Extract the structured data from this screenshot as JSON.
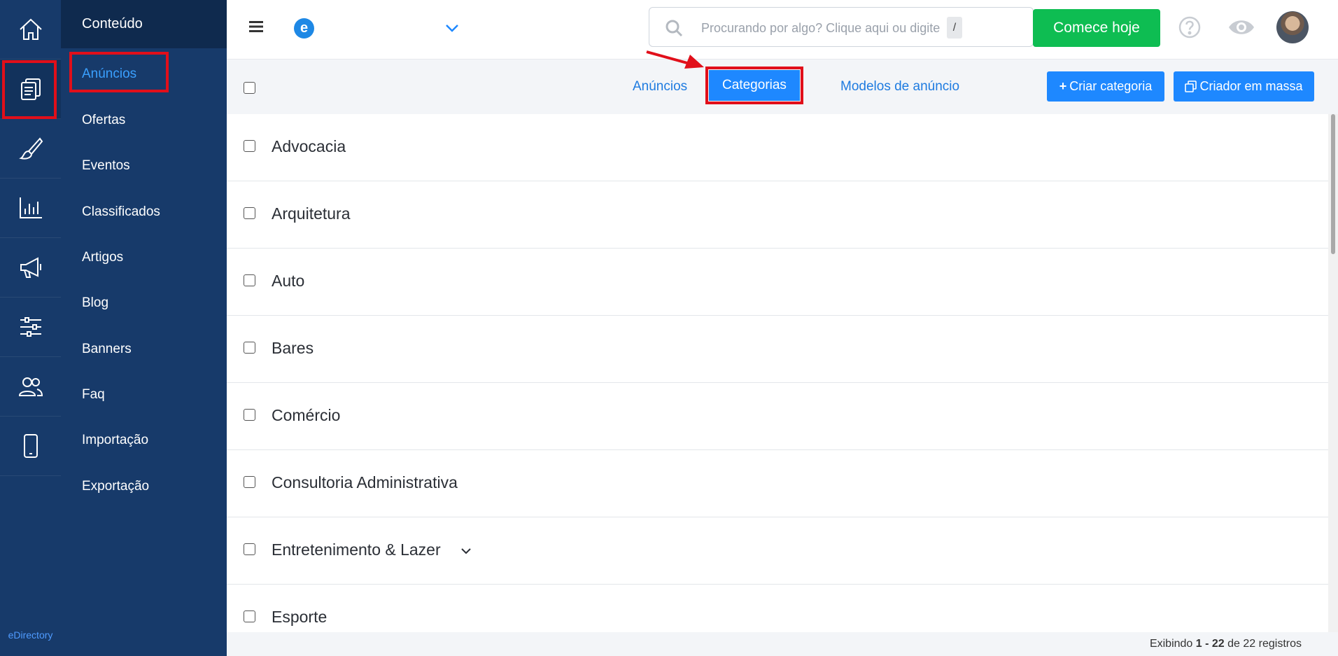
{
  "brand": "eDirectory",
  "sidebar": {
    "section_title": "Conteúdo",
    "items": [
      {
        "label": "Anúncios",
        "active": true
      },
      {
        "label": "Ofertas"
      },
      {
        "label": "Eventos"
      },
      {
        "label": "Classificados"
      },
      {
        "label": "Artigos"
      },
      {
        "label": "Blog"
      },
      {
        "label": "Banners"
      },
      {
        "label": "Faq"
      },
      {
        "label": "Importação"
      },
      {
        "label": "Exportação"
      }
    ]
  },
  "rail_icons": [
    "home-icon",
    "content-icon",
    "brush-icon",
    "chart-icon",
    "megaphone-icon",
    "settings-sliders-icon",
    "users-icon",
    "mobile-icon"
  ],
  "topbar": {
    "logo_letter": "e",
    "search_placeholder": "Procurando por algo? Clique aqui ou digite",
    "search_shortcut": "/",
    "cta_label": "Comece hoje"
  },
  "tabs": {
    "items": [
      "Anúncios",
      "Categorias",
      "Modelos de anúncio"
    ],
    "active": "Categorias",
    "create_label": "Criar categoria",
    "bulk_label": "Criador em massa"
  },
  "categories": [
    {
      "label": "Advocacia"
    },
    {
      "label": "Arquitetura"
    },
    {
      "label": "Auto"
    },
    {
      "label": "Bares"
    },
    {
      "label": "Comércio"
    },
    {
      "label": "Consultoria Administrativa"
    },
    {
      "label": "Entretenimento & Lazer",
      "expandable": true
    },
    {
      "label": "Esporte"
    }
  ],
  "footer": {
    "prefix": "Exibindo",
    "range": "1 - 22",
    "suffix": "de 22 registros"
  },
  "colors": {
    "sidebar": "#173a6a",
    "accent": "#1e88ff",
    "cta": "#0ebd52",
    "annotation": "#e10f1a"
  }
}
